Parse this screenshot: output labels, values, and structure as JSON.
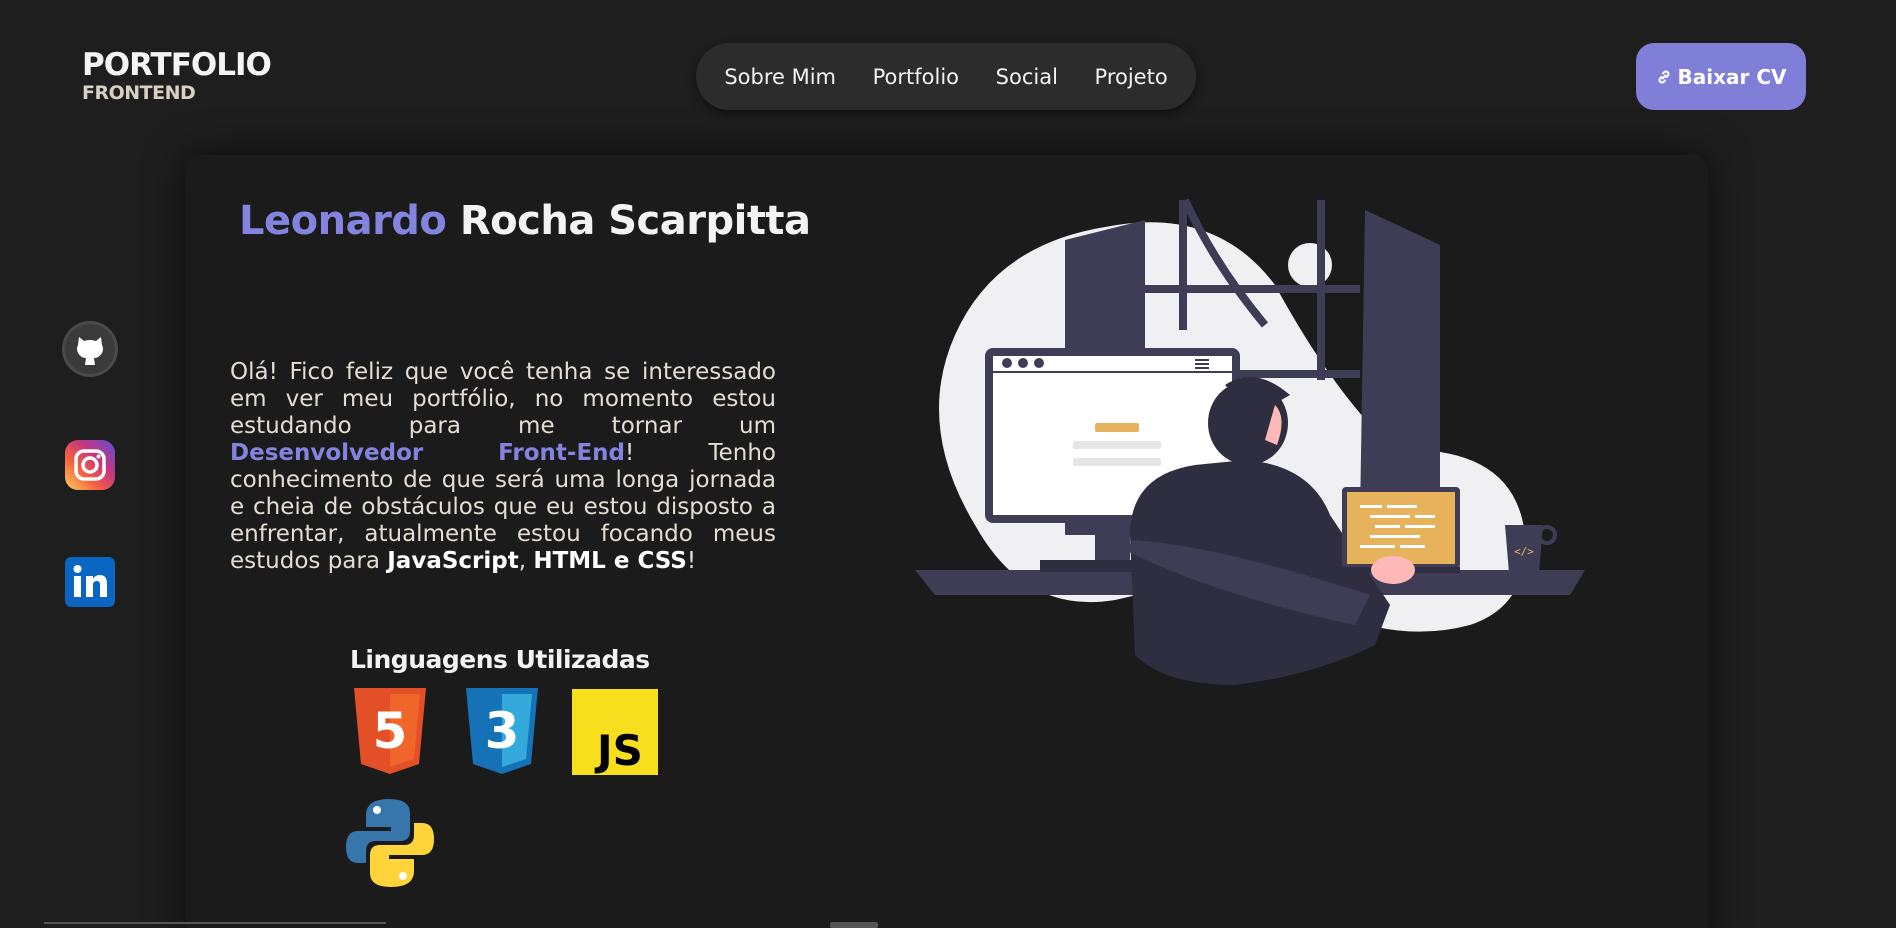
{
  "header": {
    "logo_line1": "PORTFOLIO",
    "logo_line2": "FRONTEND",
    "nav": [
      "Sobre Mim",
      "Portfolio",
      "Social",
      "Projeto"
    ],
    "cv_button": "Baixar CV"
  },
  "hero": {
    "first_name": "Leonardo",
    "last_name": "Rocha Scarpitta",
    "intro_part1": "Olá! Fico feliz que você tenha se interessado em ver meu portfólio, no momento estou estudando para me tornar um ",
    "intro_highlight": "Desenvolvedor Front-End",
    "intro_part2": "! Tenho conhecimento de que será uma longa jornada e cheia de obstáculos que eu estou disposto a enfrentar, atualmente estou focando meus estudos para ",
    "intro_js": "JavaScript",
    "intro_comma": ", ",
    "intro_html_css": "HTML e CSS",
    "intro_end": "!",
    "languages_title": "Linguagens Utilizadas",
    "css_badge": "3",
    "html_badge": "5",
    "js_badge": "JS"
  },
  "social_icons": [
    "github-icon",
    "instagram-icon",
    "linkedin-icon"
  ],
  "colors": {
    "accent": "#7f7fd8",
    "background": "#1e1e1e",
    "card": "#1b1b1b"
  }
}
